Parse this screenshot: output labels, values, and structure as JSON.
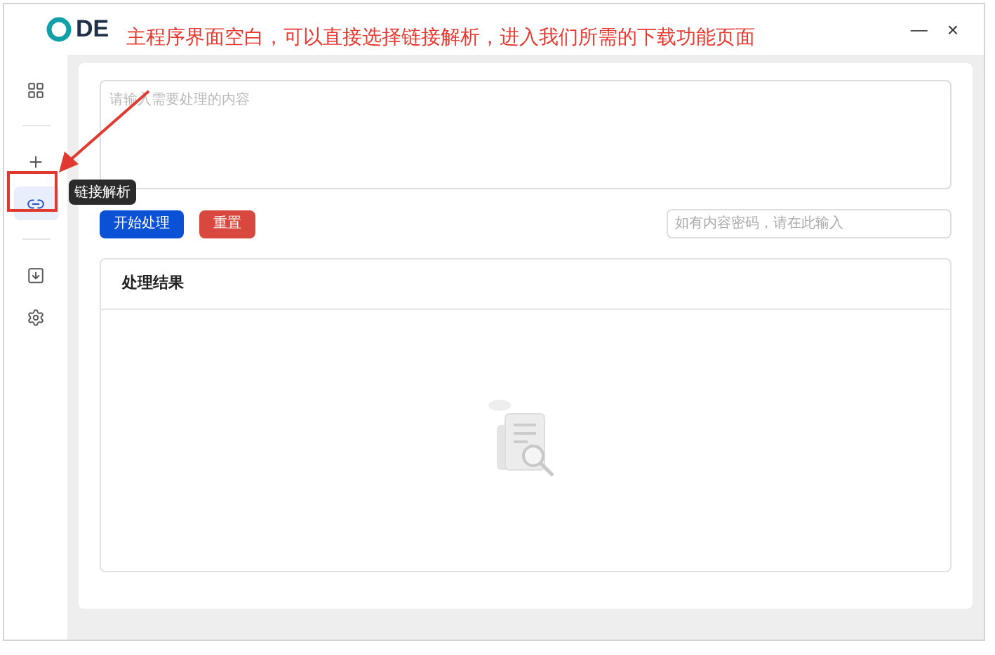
{
  "window": {
    "logo": "DE",
    "minimize": "—",
    "close": "×"
  },
  "annotation": {
    "text": "主程序界面空白，可以直接选择链接解析，进入我们所需的下载功能页面"
  },
  "sidebar": {
    "groups": [
      {
        "items": [
          {
            "selected": false
          }
        ]
      },
      {
        "items": [
          {
            "selected": false
          },
          {
            "selected": true
          }
        ]
      },
      {
        "items": [
          {
            "selected": false
          },
          {
            "selected": false
          }
        ]
      }
    ]
  },
  "tooltip": {
    "text": "链接解析"
  },
  "content_input": {
    "placeholder": "请输入需要处理的内容"
  },
  "buttons": [
    {
      "label": "开始处理",
      "kind": "primary"
    },
    {
      "label": "重置",
      "kind": "danger"
    }
  ],
  "password_input": {
    "placeholder": "如有内容密码，请在此输入"
  },
  "result": {
    "title": "处理结果"
  }
}
